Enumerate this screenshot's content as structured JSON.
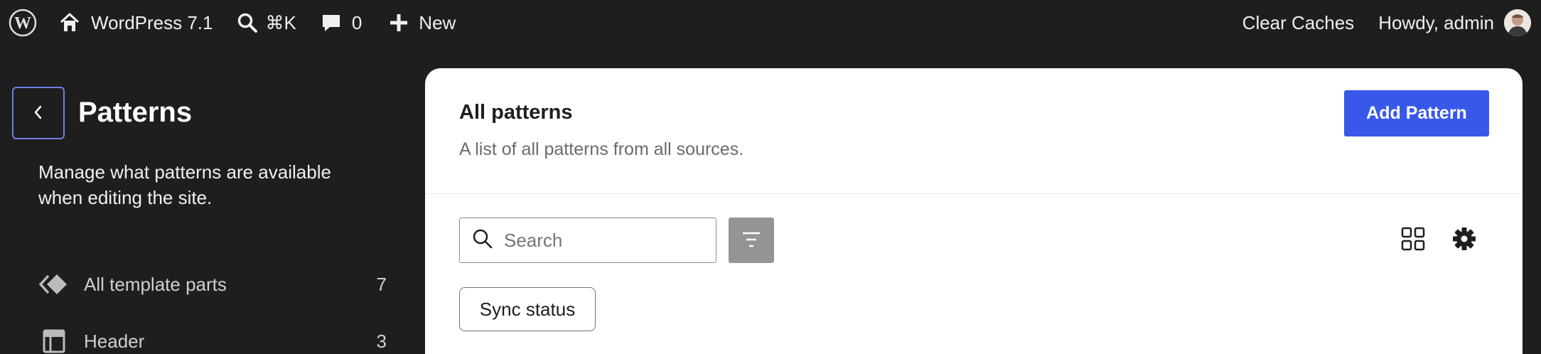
{
  "admin_bar": {
    "site_name": "WordPress 7.1",
    "shortcut": "⌘K",
    "comments_count": "0",
    "new_label": "New",
    "clear_caches": "Clear Caches",
    "howdy": "Howdy, admin"
  },
  "sidebar": {
    "title": "Patterns",
    "description": "Manage what patterns are available when editing the site.",
    "items": [
      {
        "label": "All template parts",
        "count": "7",
        "icon": "template-parts-icon"
      },
      {
        "label": "Header",
        "count": "3",
        "icon": "header-layout-icon"
      }
    ]
  },
  "main": {
    "title": "All patterns",
    "subtitle": "A list of all patterns from all sources.",
    "add_button": "Add Pattern",
    "search_placeholder": "Search",
    "filter_chip": "Sync status"
  },
  "colors": {
    "accent": "#3858e9",
    "background": "#1e1e1e",
    "focus_ring": "#6c7fe8"
  }
}
